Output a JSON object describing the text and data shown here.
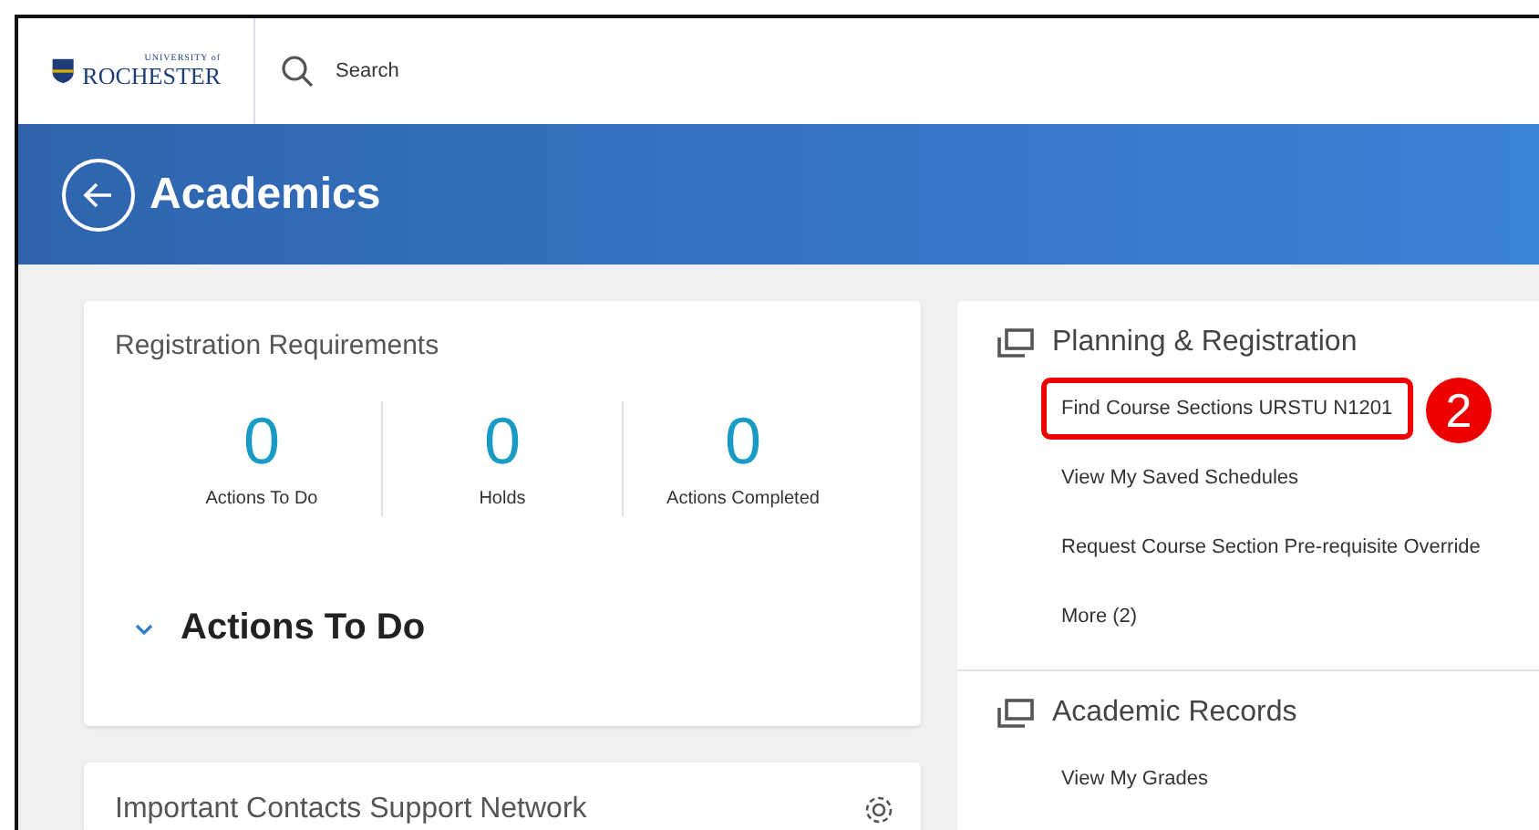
{
  "header": {
    "logo": {
      "small": "UNIVERSITY of",
      "large": "ROCHESTER"
    },
    "search": {
      "placeholder": "Search"
    }
  },
  "banner": {
    "title": "Academics"
  },
  "registration": {
    "title": "Registration Requirements",
    "stats": [
      {
        "value": "0",
        "label": "Actions To Do"
      },
      {
        "value": "0",
        "label": "Holds"
      },
      {
        "value": "0",
        "label": "Actions Completed"
      }
    ],
    "section": {
      "title": "Actions To Do",
      "expanded": true
    }
  },
  "contacts": {
    "title": "Important Contacts Support Network"
  },
  "panels": [
    {
      "title": "Planning & Registration",
      "links": [
        {
          "label": "Find Course Sections URSTU N1201",
          "highlighted": true
        },
        {
          "label": "View My Saved Schedules",
          "highlighted": false
        },
        {
          "label": "Request Course Section Pre-requisite Override",
          "highlighted": false
        },
        {
          "label": "More (2)",
          "highlighted": false
        }
      ]
    },
    {
      "title": "Academic Records",
      "links": [
        {
          "label": "View My Grades",
          "highlighted": false
        }
      ]
    }
  ],
  "callout": {
    "number": "2"
  }
}
